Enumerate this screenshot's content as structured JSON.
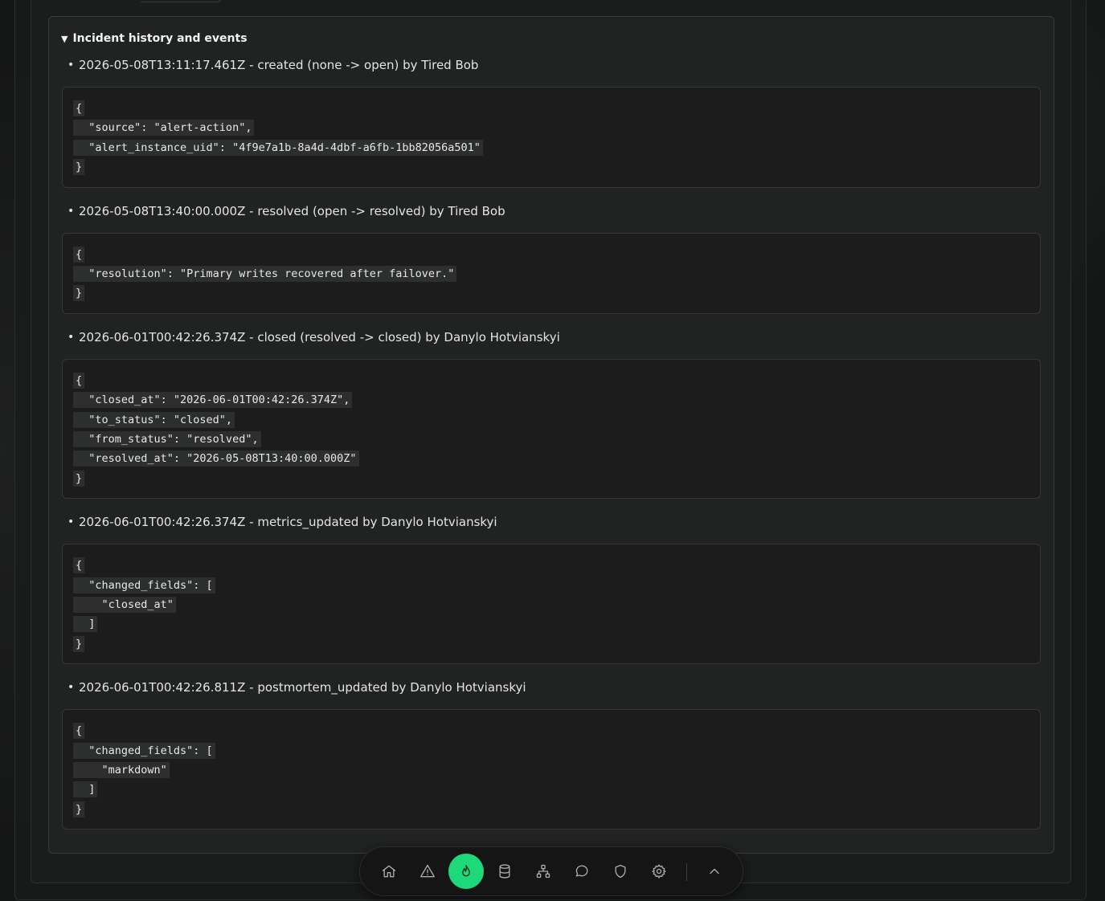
{
  "history": {
    "summary_label": "Incident history and events",
    "events": [
      {
        "title": "2026-05-08T13:11:17.461Z - created (none -> open) by Tired Bob",
        "json_lines": [
          "{",
          "  \"source\": \"alert-action\",",
          "  \"alert_instance_uid\": \"4f9e7a1b-8a4d-4dbf-a6fb-1bb82056a501\"",
          "}"
        ]
      },
      {
        "title": "2026-05-08T13:40:00.000Z - resolved (open -> resolved) by Tired Bob",
        "json_lines": [
          "{",
          "  \"resolution\": \"Primary writes recovered after failover.\"",
          "}"
        ]
      },
      {
        "title": "2026-06-01T00:42:26.374Z - closed (resolved -> closed) by Danylo Hotvianskyi",
        "json_lines": [
          "{",
          "  \"closed_at\": \"2026-06-01T00:42:26.374Z\",",
          "  \"to_status\": \"closed\",",
          "  \"from_status\": \"resolved\",",
          "  \"resolved_at\": \"2026-05-08T13:40:00.000Z\"",
          "}"
        ]
      },
      {
        "title": "2026-06-01T00:42:26.374Z - metrics_updated by Danylo Hotvianskyi",
        "json_lines": [
          "{",
          "  \"changed_fields\": [",
          "    \"closed_at\"",
          "  ]",
          "}"
        ]
      },
      {
        "title": "2026-06-01T00:42:26.811Z - postmortem_updated by Danylo Hotvianskyi",
        "json_lines": [
          "{",
          "  \"changed_fields\": [",
          "    \"markdown\"",
          "  ]",
          "}"
        ]
      }
    ]
  },
  "dock": {
    "items": [
      {
        "icon": "home-icon",
        "active": false
      },
      {
        "icon": "alert-triangle-icon",
        "active": false
      },
      {
        "icon": "flame-icon",
        "active": true
      },
      {
        "icon": "database-icon",
        "active": false
      },
      {
        "icon": "network-icon",
        "active": false
      },
      {
        "icon": "chat-bubble-icon",
        "active": false
      },
      {
        "icon": "shield-icon",
        "active": false
      },
      {
        "icon": "gear-icon",
        "active": false
      }
    ],
    "expand_icon": "chevron-up-icon"
  },
  "colors": {
    "accent": "#1ed97a",
    "background": "#151616",
    "code_bg": "#1c1c1c"
  }
}
